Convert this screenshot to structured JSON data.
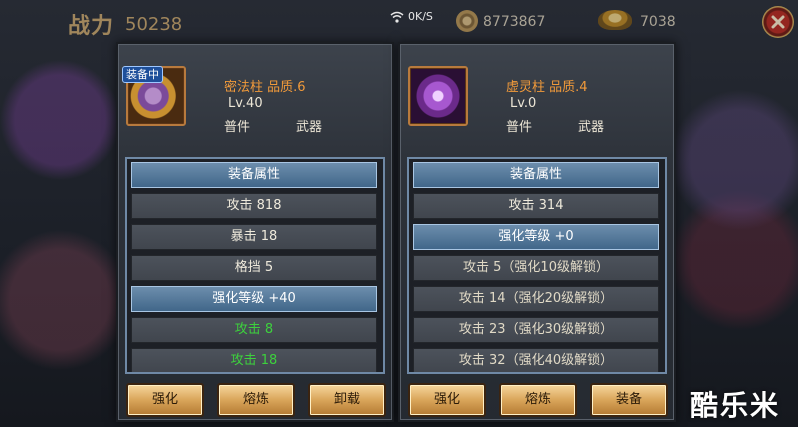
{
  "topbar": {
    "power_label": "战力",
    "power_value": "50238",
    "net_rate": "0K/S",
    "coins": "8773867",
    "ingots": "7038"
  },
  "left_panel": {
    "badge": "装备中",
    "name": "密法柱 品质.6",
    "level": "Lv.40",
    "rarity": "普件",
    "type": "武器",
    "attr_header": "装备属性",
    "stats": [
      "攻击  818",
      "暴击  18",
      "格挡  5"
    ],
    "enhance_header": "强化等级  +40",
    "bonuses": [
      "攻击 8",
      "攻击 18"
    ],
    "buttons": [
      "强化",
      "熔炼",
      "卸载"
    ]
  },
  "right_panel": {
    "name": "虚灵柱 品质.4",
    "level": "Lv.0",
    "rarity": "普件",
    "type": "武器",
    "attr_header": "装备属性",
    "stats": [
      "攻击  314"
    ],
    "enhance_header": "强化等级  +0",
    "locked_bonuses": [
      "攻击 5（强化10级解锁）",
      "攻击 14（强化20级解锁）",
      "攻击 23（强化30级解锁）",
      "攻击 32（强化40级解锁）"
    ],
    "buttons": [
      "强化",
      "熔炼",
      "装备"
    ]
  },
  "watermark": "酷乐米",
  "colors": {
    "item_name": "#f19a3a",
    "bonus_green": "#3dd13d",
    "header_blue": "#3f6588",
    "button_gold": "#d9a55a"
  }
}
